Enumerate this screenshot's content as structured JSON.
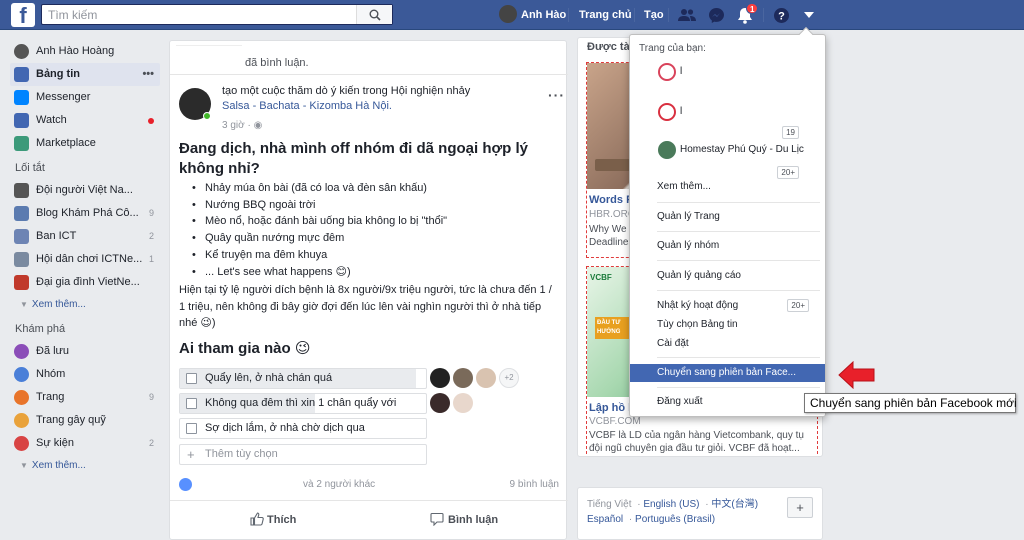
{
  "topbar": {
    "logo": "f",
    "search_placeholder": "Tìm kiếm",
    "profile_name": "Anh Hào",
    "home_label": "Trang chủ",
    "create_label": "Tạo",
    "notif_count": "1"
  },
  "leftnav": {
    "profile": "Anh Hào Hoàng",
    "main": [
      {
        "label": "Bảng tin",
        "icon": "news-feed-icon",
        "color": "#4267b2"
      },
      {
        "label": "Messenger",
        "icon": "messenger-icon",
        "color": "#0084ff"
      },
      {
        "label": "Watch",
        "icon": "watch-icon",
        "color": "#4267b2"
      },
      {
        "label": "Marketplace",
        "icon": "marketplace-icon",
        "color": "#3c9a7a"
      }
    ],
    "shortcuts_head": "Lối tắt",
    "shortcuts": [
      {
        "label": "Đội người Việt Na...",
        "count": "",
        "color": "#555"
      },
      {
        "label": "Blog Khám Phá Cô...",
        "count": "9",
        "color": "#5b7bb0"
      },
      {
        "label": "Ban ICT",
        "count": "2",
        "color": "#6d84b4"
      },
      {
        "label": "Hội dân chơi ICTNe...",
        "count": "1",
        "color": "#7a8aa0"
      },
      {
        "label": "Đại gia đình VietNe...",
        "count": "",
        "color": "#c0392b"
      }
    ],
    "more1": "Xem thêm...",
    "explore_head": "Khám phá",
    "explore": [
      {
        "label": "Đã lưu",
        "count": "",
        "color": "#8b4db8"
      },
      {
        "label": "Nhóm",
        "count": "",
        "color": "#4a7fd8"
      },
      {
        "label": "Trang",
        "count": "9",
        "color": "#e8742a"
      },
      {
        "label": "Trang gây quỹ",
        "count": "",
        "color": "#e9a23b"
      },
      {
        "label": "Sự kiện",
        "count": "2",
        "color": "#d84444"
      }
    ],
    "more2": "Xem thêm..."
  },
  "feed": {
    "top_text": "đã bình luận.",
    "header_line1": "tạo một cuộc thăm dò ý kiến trong Hội nghiện nhảy",
    "header_line2": "Salsa - Bachata - Kizomba Hà Nội.",
    "time": "3 giờ ·",
    "title": "Đang dịch, nhà mình off nhóm đi dã ngoại hợp lý không nhỉ?",
    "bullets": [
      "Nhảy múa ôn bài (đã có loa và đèn sân khấu)",
      "Nướng BBQ ngoài trời",
      "Mèo nổ, hoặc đánh bài uống bia không lo bị \"thổi\"",
      "Quây quần nướng mực đêm",
      "Kể truyện ma đêm khuya",
      "... Let's see what happens 😊)"
    ],
    "body": "Hiện tại tỷ lệ người dích bệnh là 8x người/9x triệu người, tức là chưa đến 1 / 1 triệu, nên không đi bây giờ đợi đến lúc lên vài nghìn người thì ở nhà tiếp nhé 😉)",
    "poll_heading": "Ai tham gia nào 😉",
    "poll_options": [
      {
        "text": "Quẩy lên, ở nhà chán quá",
        "fill": 0.96
      },
      {
        "text": "Không qua đêm thì xin 1 chân quẩy với",
        "fill": 0.55
      },
      {
        "text": "Sợ dịch lắm, ở nhà chờ dịch qua",
        "fill": 0
      },
      {
        "text": "Thêm tùy chọn",
        "fill": 0
      }
    ],
    "extra_voters": "+2",
    "reactions": "và 2 người khác",
    "comments": "9 bình luận",
    "like_label": "Thích",
    "comment_label": "Bình luận"
  },
  "rightcol": {
    "sponsored": "Được tài",
    "ad1": {
      "title": "Words F",
      "url": "HBR.ORG",
      "desc": "Why We Deadlines"
    },
    "ad2": {
      "title": "Lập hồ h",
      "url": "VCBF.COM",
      "desc": "VCBF là LD của ngân hàng Vietcombank, quy tụ đội ngũ chuyên gia đầu tư giỏi. VCBF đã hoạt...",
      "brand": "VCBF",
      "banner": "ĐẦU TƯ HƯỚNG"
    },
    "languages": [
      "Tiếng Việt",
      "English (US)",
      "中文(台灣)",
      "Español",
      "Português (Brasil)"
    ],
    "plus": "+"
  },
  "dropdown": {
    "your_pages": "Trang của bạn:",
    "pages": [
      {
        "name": "l",
        "count": "",
        "color": "#d9435b"
      },
      {
        "name": "l",
        "count": "19",
        "color": "#d93040"
      },
      {
        "name": "Homestay Phú Quý - Du Lịc",
        "count": "20+",
        "color": "#4a7a5a"
      }
    ],
    "see_more": "Xem thêm...",
    "manage_page": "Quản lý Trang",
    "manage_groups": "Quản lý nhóm",
    "manage_ads": "Quản lý quảng cáo",
    "activity_log": "Nhật ký hoạt động",
    "activity_count": "20+",
    "news_pref": "Tùy chọn Bảng tin",
    "settings": "Cài đặt",
    "switch": "Chuyển sang phiên bản Face...",
    "logout": "Đăng xuất"
  },
  "tooltip": "Chuyển sang phiên bản Facebook mới",
  "colors": {
    "brand": "#3b5998",
    "highlight": "#4267b2",
    "annotation": "#e8202a"
  }
}
